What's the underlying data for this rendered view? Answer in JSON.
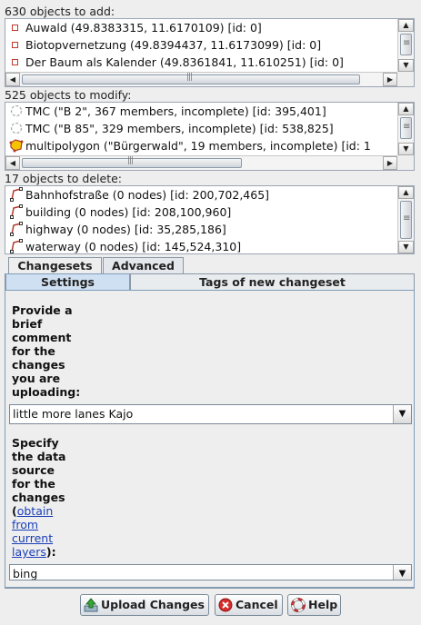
{
  "add": {
    "label": "630 objects to add:",
    "items": [
      "Auwald (49.8383315, 11.6170109) [id: 0]",
      "Biotopvernetzung (49.8394437, 11.6173099) [id: 0]",
      "Der Baum als Kalender (49.8361841, 11.610251) [id: 0]"
    ]
  },
  "modify": {
    "label": "525 objects to modify:",
    "items": [
      "TMC (\"B 2\", 367 members, incomplete) [id: 395,401]",
      "TMC (\"B 85\", 329 members, incomplete) [id: 538,825]",
      "multipolygon (\"Bürgerwald\", 19 members, incomplete) [id: 1"
    ]
  },
  "delete": {
    "label": "17 objects to delete:",
    "items": [
      "Bahnhofstraße (0 nodes) [id: 200,702,465]",
      "building (0 nodes) [id: 208,100,960]",
      "highway (0 nodes) [id: 35,285,186]",
      "waterway (0 nodes) [id: 145,524,310]"
    ]
  },
  "tabs": {
    "changesets": "Changesets",
    "advanced": "Advanced"
  },
  "subtabs": {
    "settings": "Settings",
    "tags": "Tags of new changeset"
  },
  "comment": {
    "label_lines": [
      "Provide a",
      "brief",
      "comment",
      "for the",
      "changes",
      "you are",
      "uploading:"
    ],
    "value": "little more lanes Kajo"
  },
  "source": {
    "label_lines": [
      "Specify",
      "the data",
      "source",
      "for the",
      "changes"
    ],
    "link_lines": [
      "obtain",
      "from",
      "current",
      "layers"
    ],
    "value": "bing"
  },
  "buttons": {
    "upload": "Upload Changes",
    "cancel": "Cancel",
    "help": "Help"
  },
  "colors": {
    "link": "#1a3fb8",
    "selected_subtab": "#cfe0f2"
  }
}
